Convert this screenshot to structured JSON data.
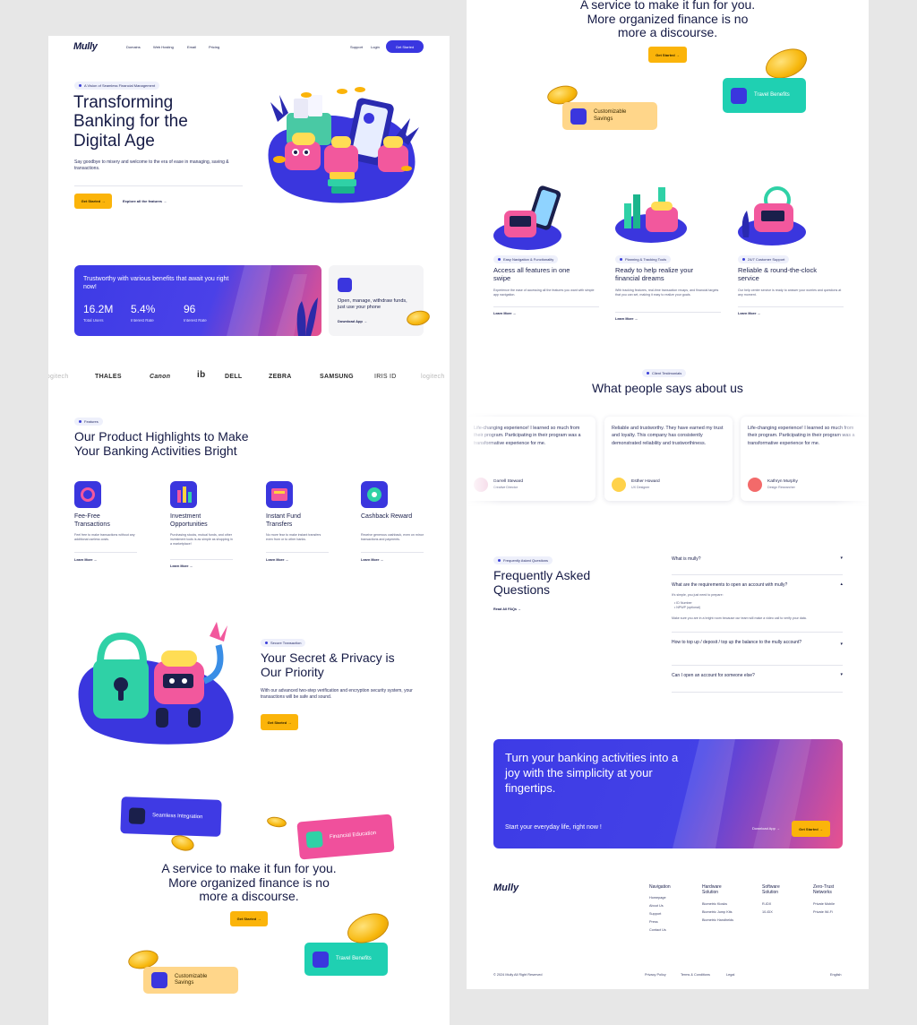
{
  "nav": {
    "logo": "Mully",
    "links": [
      "Domains",
      "Web Hosting",
      "Email",
      "Pricing"
    ],
    "support": "Support",
    "login": "Login",
    "cta": "Get Started"
  },
  "hero": {
    "badge": "A Vision of Seamless Financial Management",
    "title_lines": [
      "Transforming",
      "Banking for the",
      "Digital Age"
    ],
    "subtitle": "Say goodbye to misery and welcome to the era of ease in managing, saving & transactions.",
    "cta": "Get Started →",
    "secondary": "Explore all the features →"
  },
  "stats": {
    "heading": "Trustworthy with various benefits that await you right now!",
    "items": [
      {
        "value": "16.2M",
        "label": "Total Users"
      },
      {
        "value": "5.4%",
        "label": "Interest Rate"
      },
      {
        "value": "96",
        "label": "Interest Rate"
      }
    ],
    "app_text": "Open, manage, withdraw funds, just use your phone",
    "app_link": "Download App →"
  },
  "logos": [
    "logitech",
    "THALES",
    "Canon",
    "ib",
    "DELL",
    "ZEBRA",
    "SAMSUNG",
    "IRIS ID",
    "logitech"
  ],
  "features": {
    "badge": "Features",
    "title_lines": [
      "Our Product Highlights to Make",
      "Your Banking Activities Bright"
    ],
    "items": [
      {
        "title": "Fee-Free Transactions",
        "desc": "Feel free to make transactions without any additional useless costs.",
        "link": "Learn More →",
        "color": "#3a36de"
      },
      {
        "title": "Investment Opportunities",
        "desc": "Purchasing stocks, mutual funds, and other investment tools is as simple as shopping in a marketplace!",
        "link": "Learn More →",
        "color": "#3a36de"
      },
      {
        "title": "Instant Fund Transfers",
        "desc": "No more fear to make instant transfers even from or to other banks.",
        "link": "Learn More →",
        "color": "#3a36de"
      },
      {
        "title": "Cashback Reward",
        "desc": "Receive generous cashback, even on minor transactions and payments.",
        "link": "Learn More →",
        "color": "#3a36de"
      }
    ]
  },
  "security": {
    "badge": "Secure Transaction",
    "title_lines": [
      "Your Secret & Privacy is",
      "Our Priority"
    ],
    "desc": "With our advanced two-step verification and encryption security system, your transactions will be safe and sound.",
    "cta": "Get Started →"
  },
  "fun": {
    "tags": [
      {
        "label": "Seamless Integration",
        "color": "#3f3ae4"
      },
      {
        "label": "Financial Education",
        "color": "#f0509c"
      },
      {
        "label": "Customizable Savings",
        "color": "#ffd68a"
      },
      {
        "label": "Travel Benefits",
        "color": "#1fd0b2"
      }
    ],
    "title_lines": [
      "A service to make it fun for you.",
      "More organized finance is no",
      "more a discourse."
    ],
    "cta": "Get Started →"
  },
  "right_fun": {
    "title_lines": [
      "A service to make it fun for you.",
      "More organized finance is no",
      "more a discourse."
    ],
    "cta": "Get Started →",
    "tags": [
      {
        "label": "Travel Benefits"
      },
      {
        "label": "Customizable Savings"
      }
    ]
  },
  "cards3": [
    {
      "badge": "Easy Navigation & Functionality",
      "title": "Access all features in one swipe",
      "desc": "Experience the ease of accessing all the features you want with simple app navigation.",
      "link": "Learn More →"
    },
    {
      "badge": "Planning & Tracking Tools",
      "title": "Ready to help realize your financial dreams",
      "desc": "With tracking features, real-time transaction recaps, and financial targets that you can set, making it easy to realize your goals.",
      "link": "Learn More →"
    },
    {
      "badge": "24/7 Customer Support",
      "title": "Reliable & round-the-clock service",
      "desc": "Our help center service is ready to answer your worries and questions at any moment.",
      "link": "Learn More →"
    }
  ],
  "testimonials": {
    "badge": "Client Testimonials",
    "title": "What people says about us",
    "items": [
      {
        "quote": "Life-changing experience! I learned so much from their program. Participating in their program was a transformative experience for me.",
        "name": "Darrell Steward",
        "role": "Creative Director",
        "color": "#f1c9de"
      },
      {
        "quote": "Reliable and trustworthy. They have earned my trust and loyalty. This company has consistently demonstrated reliability and trustworthiness.",
        "name": "Esther Howard",
        "role": "UX Designer",
        "color": "#ffd24a"
      },
      {
        "quote": "Life-changing experience! I learned so much from their program. Participating in their program was a transformative experience for me.",
        "name": "Kathryn Murphy",
        "role": "Design Researcher",
        "color": "#f36a6a"
      }
    ]
  },
  "faq": {
    "badge": "Frequently Asked Questions",
    "title_lines": [
      "Frequently Asked",
      "Questions"
    ],
    "read_all": "Read All FAQs →",
    "items": [
      {
        "q": "What is mully?",
        "open": false
      },
      {
        "q": "What are the requirements to open an account with mully?",
        "open": true,
        "answer_intro": "It's simple, you just need to prepare:",
        "answer_list": [
          "ID Number",
          "NPWP (optional)"
        ],
        "answer_outro": "Make sure you are in a bright room because our team will make a video call to verify your data."
      },
      {
        "q": "How to top up / deposit / top up the balance to the mully account?",
        "open": false
      },
      {
        "q": "Can I open an account for someone else?",
        "open": false
      }
    ]
  },
  "cta_banner": {
    "title_lines": [
      "Turn your banking activities into a",
      "joy with the simplicity at your",
      "fingertips."
    ],
    "sub": "Start your everyday life, right now !",
    "download": "Download App →",
    "cta": "Get Started →"
  },
  "footer": {
    "logo": "Mully",
    "columns": [
      {
        "title_lines": [
          "Navigation"
        ],
        "links": [
          "Homepage",
          "About Us",
          "Support",
          "Press",
          "Contact Us"
        ]
      },
      {
        "title_lines": [
          "Hardware",
          "Solution"
        ],
        "links": [
          "Biometric Kiosks",
          "Biometric Jump Kits",
          "Biometric Handhelds"
        ]
      },
      {
        "title_lines": [
          "Software",
          "Solution"
        ],
        "links": [
          "R-IDX",
          "10-IDX"
        ]
      },
      {
        "title_lines": [
          "Zero-Trust",
          "Networks"
        ],
        "links": [
          "Private Mobile",
          "Private Wi-Fi"
        ]
      }
    ],
    "copyright": "© 2024 Mully All Right Reserved",
    "legal": [
      "Privacy Policy",
      "Terms & Conditions",
      "Legal"
    ],
    "language": "English"
  }
}
